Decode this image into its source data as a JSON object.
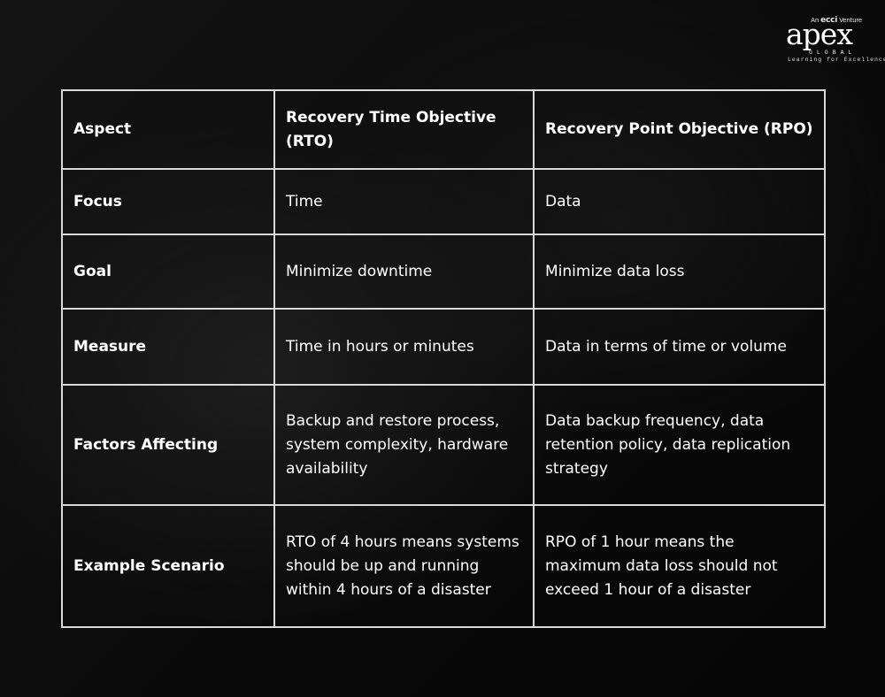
{
  "logo": {
    "tagline_prefix": "An",
    "tagline_brand": "ecci",
    "tagline_suffix": "Venture",
    "wordmark": "apex",
    "sub": "GLOBAL",
    "slogan": "Learning for Excellence"
  },
  "table": {
    "headers": [
      "Aspect",
      "Recovery Time Objective (RTO)",
      "Recovery Point Objective (RPO)"
    ],
    "rows": [
      {
        "aspect": "Focus",
        "rto": "Time",
        "rpo": "Data"
      },
      {
        "aspect": "Goal",
        "rto": "Minimize downtime",
        "rpo": "Minimize data loss"
      },
      {
        "aspect": "Measure",
        "rto": "Time in hours or minutes",
        "rpo": "Data in terms of time or volume"
      },
      {
        "aspect": "Factors Affecting",
        "rto": "Backup and restore process, system complexity, hardware availability",
        "rpo": "Data backup frequency, data retention policy, data replication strategy"
      },
      {
        "aspect": "Example Scenario",
        "rto": "RTO of 4 hours means systems should be up and running within 4 hours of a disaster",
        "rpo": "RPO of 1 hour means the maximum data loss should not exceed 1 hour of a disaster"
      }
    ]
  },
  "colors": {
    "background": "#0b0b0b",
    "border": "#d9d9d9",
    "text": "#ffffff"
  }
}
